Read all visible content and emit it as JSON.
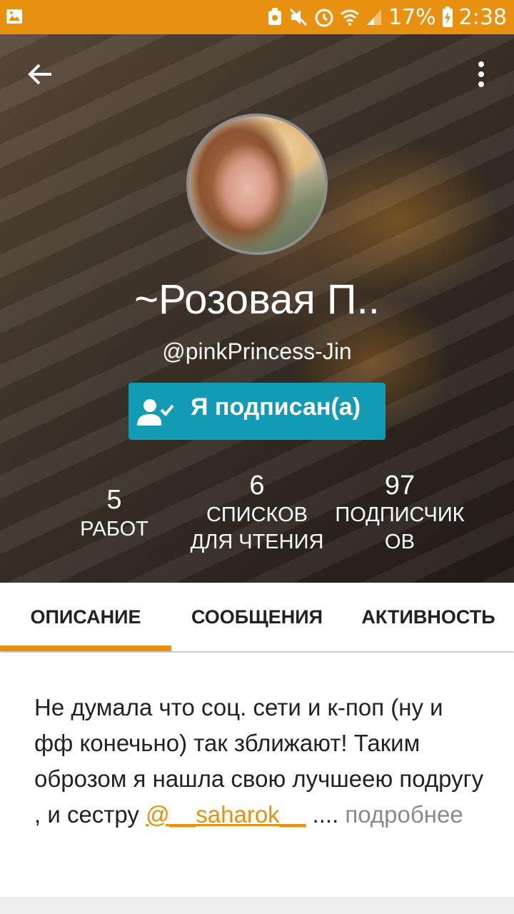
{
  "status_bar": {
    "battery": "17%",
    "time": "2:38",
    "icons": [
      "image-icon",
      "alarm-icon",
      "mute-icon",
      "clock-icon",
      "wifi-icon",
      "signal-icon",
      "battery-icon"
    ]
  },
  "profile": {
    "display_name": "~Розовая П..",
    "handle": "@pinkPrincess-Jin",
    "follow_button_label": "Я подписан(а)"
  },
  "stats": [
    {
      "value": "5",
      "label": "РАБОТ"
    },
    {
      "value": "6",
      "label": "СПИСКОВ ДЛЯ ЧТЕНИЯ"
    },
    {
      "value": "97",
      "label": "ПОДПИСЧИК ОВ"
    }
  ],
  "tabs": [
    {
      "label": "ОПИСАНИЕ",
      "active": true
    },
    {
      "label": "СООБЩЕНИЯ",
      "active": false
    },
    {
      "label": "АКТИВНОСТЬ",
      "active": false
    }
  ],
  "description": {
    "text": "Не думала что соц. сети и к-поп (ну и фф конечьно) так зближают! Таким оброзом я нашла свою лучшеею подругу , и сестру ",
    "mention": "@__saharok__",
    "ellipsis": " ....",
    "more_label": "подробнее"
  },
  "colors": {
    "accent": "#e8900f",
    "follow_button": "#129bb4"
  }
}
